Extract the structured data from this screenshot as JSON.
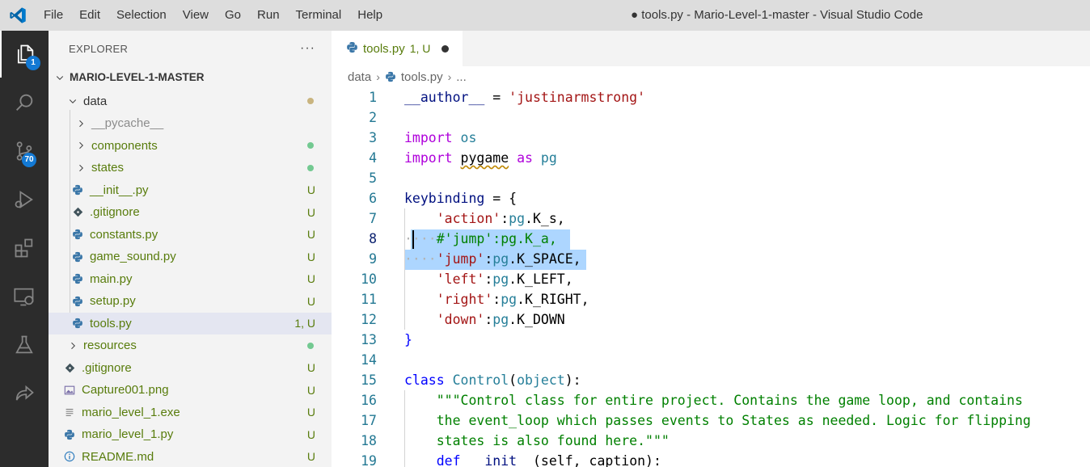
{
  "menu": [
    "File",
    "Edit",
    "Selection",
    "View",
    "Go",
    "Run",
    "Terminal",
    "Help"
  ],
  "window_title": "● tools.py - Mario-Level-1-master - Visual Studio Code",
  "activity": {
    "explorer_badge": "1",
    "scm_badge": "70"
  },
  "sidebar": {
    "title": "EXPLORER",
    "more": "···",
    "root": "MARIO-LEVEL-1-MASTER",
    "items": [
      {
        "label": "data",
        "type": "folder-open",
        "depth": 1,
        "deco": "dot",
        "dot_color": "#c9b47f"
      },
      {
        "label": "__pycache__",
        "type": "folder",
        "depth": 2,
        "deco": "",
        "label_color": "#8c8c8c"
      },
      {
        "label": "components",
        "type": "folder",
        "depth": 2,
        "deco": "dot",
        "dot_color": "#73c991",
        "label_color": "#587c0c"
      },
      {
        "label": "states",
        "type": "folder",
        "depth": 2,
        "deco": "dot",
        "dot_color": "#73c991",
        "label_color": "#587c0c"
      },
      {
        "label": "__init__.py",
        "type": "py",
        "depth": 2,
        "deco": "U",
        "label_color": "#587c0c"
      },
      {
        "label": ".gitignore",
        "type": "git",
        "depth": 2,
        "deco": "U",
        "label_color": "#587c0c"
      },
      {
        "label": "constants.py",
        "type": "py",
        "depth": 2,
        "deco": "U",
        "label_color": "#587c0c"
      },
      {
        "label": "game_sound.py",
        "type": "py",
        "depth": 2,
        "deco": "U",
        "label_color": "#587c0c"
      },
      {
        "label": "main.py",
        "type": "py",
        "depth": 2,
        "deco": "U",
        "label_color": "#587c0c"
      },
      {
        "label": "setup.py",
        "type": "py",
        "depth": 2,
        "deco": "U",
        "label_color": "#587c0c"
      },
      {
        "label": "tools.py",
        "type": "py",
        "depth": 2,
        "deco": "1, U",
        "label_color": "#587c0c",
        "selected": true
      },
      {
        "label": "resources",
        "type": "folder",
        "depth": 1,
        "deco": "dot",
        "dot_color": "#73c991",
        "label_color": "#587c0c"
      },
      {
        "label": ".gitignore",
        "type": "git",
        "depth": 1,
        "deco": "U",
        "label_color": "#587c0c"
      },
      {
        "label": "Capture001.png",
        "type": "img",
        "depth": 1,
        "deco": "U",
        "label_color": "#587c0c"
      },
      {
        "label": "mario_level_1.exe",
        "type": "exe",
        "depth": 1,
        "deco": "U",
        "label_color": "#587c0c"
      },
      {
        "label": "mario_level_1.py",
        "type": "py",
        "depth": 1,
        "deco": "U",
        "label_color": "#587c0c"
      },
      {
        "label": "README.md",
        "type": "info",
        "depth": 1,
        "deco": "U",
        "label_color": "#587c0c"
      }
    ]
  },
  "tab": {
    "name": "tools.py",
    "status": "1, U"
  },
  "breadcrumb": [
    "data",
    "tools.py",
    "..."
  ],
  "code": {
    "lines": [
      {
        "n": "1",
        "tokens": [
          [
            "var",
            "__author__"
          ],
          [
            "",
            " = "
          ],
          [
            "str",
            "'justinarmstrong'"
          ]
        ]
      },
      {
        "n": "2",
        "tokens": []
      },
      {
        "n": "3",
        "tokens": [
          [
            "kw",
            "import"
          ],
          [
            "",
            " "
          ],
          [
            "mod",
            "os"
          ]
        ]
      },
      {
        "n": "4",
        "tokens": [
          [
            "kw",
            "import"
          ],
          [
            "",
            " "
          ],
          [
            "sq",
            "pygame"
          ],
          [
            "",
            " "
          ],
          [
            "kw",
            "as"
          ],
          [
            "",
            " "
          ],
          [
            "mod",
            "pg"
          ]
        ]
      },
      {
        "n": "5",
        "tokens": []
      },
      {
        "n": "6",
        "tokens": [
          [
            "var",
            "keybinding"
          ],
          [
            "",
            " = {"
          ]
        ]
      },
      {
        "n": "7",
        "tokens": [
          [
            "",
            "    "
          ],
          [
            "str",
            "'action'"
          ],
          [
            "",
            ":"
          ],
          [
            "mod",
            "pg"
          ],
          [
            "",
            ".K_s,"
          ]
        ]
      },
      {
        "n": "8",
        "tokens": [
          [
            "ws",
            "····"
          ],
          [
            "com",
            "#'jump':pg.K_a,"
          ]
        ]
      },
      {
        "n": "9",
        "tokens": [
          [
            "ws",
            "····"
          ],
          [
            "str",
            "'jump'"
          ],
          [
            "",
            ":"
          ],
          [
            "mod",
            "pg"
          ],
          [
            "",
            ".K_SPACE,"
          ]
        ]
      },
      {
        "n": "10",
        "tokens": [
          [
            "",
            "    "
          ],
          [
            "str",
            "'left'"
          ],
          [
            "",
            ":"
          ],
          [
            "mod",
            "pg"
          ],
          [
            "",
            ".K_LEFT,"
          ]
        ]
      },
      {
        "n": "11",
        "tokens": [
          [
            "",
            "    "
          ],
          [
            "str",
            "'right'"
          ],
          [
            "",
            ":"
          ],
          [
            "mod",
            "pg"
          ],
          [
            "",
            ".K_RIGHT,"
          ]
        ]
      },
      {
        "n": "12",
        "tokens": [
          [
            "",
            "    "
          ],
          [
            "str",
            "'down'"
          ],
          [
            "",
            ":"
          ],
          [
            "mod",
            "pg"
          ],
          [
            "",
            ".K_DOWN"
          ]
        ]
      },
      {
        "n": "13",
        "tokens": [
          [
            "kw2",
            "}"
          ]
        ]
      },
      {
        "n": "14",
        "tokens": []
      },
      {
        "n": "15",
        "tokens": [
          [
            "kw2",
            "class"
          ],
          [
            "",
            " "
          ],
          [
            "cls",
            "Control"
          ],
          [
            "",
            "("
          ],
          [
            "cls",
            "object"
          ],
          [
            "",
            "):"
          ]
        ]
      },
      {
        "n": "16",
        "tokens": [
          [
            "",
            "    "
          ],
          [
            "com",
            "\"\"\"Control class for entire project. Contains the game loop, and contains"
          ]
        ]
      },
      {
        "n": "17",
        "tokens": [
          [
            "",
            "    "
          ],
          [
            "com",
            "the event_loop which passes events to States as needed. Logic for flipping"
          ]
        ]
      },
      {
        "n": "18",
        "tokens": [
          [
            "",
            "    "
          ],
          [
            "com",
            "states is also found here.\"\"\""
          ]
        ]
      },
      {
        "n": "19",
        "tokens": [
          [
            "",
            "    "
          ],
          [
            "kw2",
            "def"
          ],
          [
            "",
            " "
          ],
          [
            "var",
            "__init__"
          ],
          [
            "",
            "(self, caption):"
          ]
        ]
      }
    ]
  }
}
